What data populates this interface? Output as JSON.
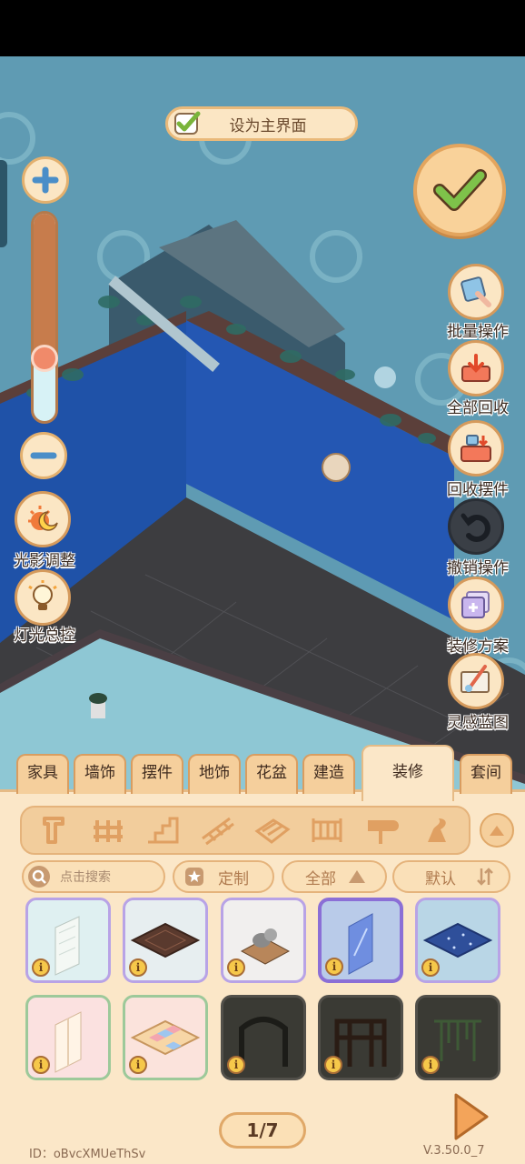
{
  "top_banner": {
    "label": "设为主界面"
  },
  "zoom": {
    "level": 0.28
  },
  "left_buttons": [
    {
      "label": "光影调整",
      "icon": "sun-moon-icon"
    },
    {
      "label": "灯光总控",
      "icon": "lightbulb-icon"
    }
  ],
  "right_buttons": [
    {
      "label": "批量操作",
      "icon": "batch-select-icon"
    },
    {
      "label": "全部回收",
      "icon": "recycle-all-icon"
    },
    {
      "label": "回收摆件",
      "icon": "recycle-ornament-icon"
    },
    {
      "label": "撤销操作",
      "icon": "undo-icon"
    },
    {
      "label": "装修方案",
      "icon": "decor-plan-icon"
    },
    {
      "label": "灵感蓝图",
      "icon": "blueprint-icon"
    }
  ],
  "tabs": [
    {
      "label": "家具",
      "active": false
    },
    {
      "label": "墙饰",
      "active": false
    },
    {
      "label": "摆件",
      "active": false
    },
    {
      "label": "地饰",
      "active": false
    },
    {
      "label": "花盆",
      "active": false
    },
    {
      "label": "建造",
      "active": false
    },
    {
      "label": "装修",
      "active": true
    },
    {
      "label": "套间",
      "active": false
    }
  ],
  "subcategories": [
    "wall-icon",
    "fence-icon",
    "stairs-icon",
    "railing-icon",
    "roof-tile-icon",
    "gate-icon",
    "mailbox-icon",
    "stove-icon"
  ],
  "filters": {
    "search_placeholder": "点击搜索",
    "custom_label": "定制",
    "all_label": "全部",
    "default_label": "默认"
  },
  "items": [
    {
      "name": "lace-wallpaper",
      "bg": "#dff0f1",
      "border": "#b8a3e6"
    },
    {
      "name": "dark-wood-floor",
      "bg": "#e7eef0",
      "border": "#b8a3e6"
    },
    {
      "name": "cat-desk-decor",
      "bg": "#f1efee",
      "border": "#b8a3e6"
    },
    {
      "name": "blue-glass-wallpaper",
      "bg": "#b9cbe9",
      "border": "#8b6fd6",
      "selected": true
    },
    {
      "name": "starry-floor",
      "bg": "#b9d6e6",
      "border": "#b8a3e6"
    },
    {
      "name": "pink-panel-wallpaper",
      "bg": "#fbe1e0",
      "border": "#9dc99a"
    },
    {
      "name": "patchwork-floor",
      "bg": "#fbe3dc",
      "border": "#9dc99a"
    },
    {
      "name": "dark-arch-wall",
      "bg": "#3a3a34",
      "border": "#52504a"
    },
    {
      "name": "dark-fence-wall",
      "bg": "#3a3a34",
      "border": "#52504a"
    },
    {
      "name": "vine-arch-wall",
      "bg": "#3a3a34",
      "border": "#52504a"
    }
  ],
  "pager": {
    "label": "1/7"
  },
  "footer": {
    "user_id": "ID：oBvcXMUeThSv",
    "version": "V.3.50.0_7"
  },
  "colors": {
    "scene_bg": "#5f9bb3",
    "panel_bg": "#fbe7c8",
    "accent": "#e0a868"
  }
}
